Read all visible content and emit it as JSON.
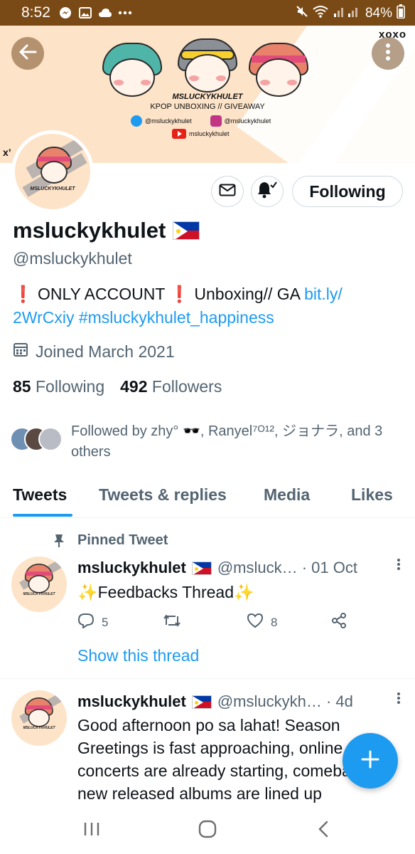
{
  "status_bar": {
    "time": "8:52",
    "icons": [
      "messenger-icon",
      "gallery-icon",
      "cloud-icon",
      "more-dots-icon"
    ],
    "battery": "84%"
  },
  "banner": {
    "brand": "MSLUCKYKHULET",
    "tagline": "KPOP UNBOXING // GIVEAWAY",
    "twitter": "@msluckykhulet",
    "instagram": "@msluckykhulet",
    "youtube": "msluckykhulet",
    "xoxo": "xoxo",
    "xo_left": "x’"
  },
  "avatar_label": "MSLUCKYKHULET",
  "profile": {
    "display_name": "msluckykhulet",
    "handle": "@msluckykhulet",
    "bio_excl_1": "❗",
    "bio_part_1": " ONLY ACCOUNT ",
    "bio_excl_2": "❗",
    "bio_part_2": " Unboxing// GA ",
    "bio_link": "bit.ly/",
    "bio_link_2": "2WrCxiy",
    "bio_hashtag": " #msluckykhulet_happiness",
    "joined": "Joined March 2021",
    "following_count": "85",
    "following_label": "Following",
    "followers_count": "492",
    "followers_label": "Followers",
    "followed_by": "Followed by zhy° 🕶️, Ranyel⁷ᴼ¹², ジョナラ, and 3 others"
  },
  "follow_button": "Following",
  "tabs": [
    "Tweets",
    "Tweets & replies",
    "Media",
    "Likes"
  ],
  "tweets": [
    {
      "pinned_label": "Pinned Tweet",
      "name": "msluckykhulet",
      "meta": "@msluck… · 01 Oct",
      "body": "✨Feedbacks Thread✨",
      "replies": "5",
      "retweets": "",
      "likes": "8",
      "show_thread": "Show this thread"
    },
    {
      "name": "msluckykhulet",
      "meta": "@msluckykh… · 4d",
      "body": "Good afternoon po sa lahat! Season Greetings is fast approaching, online concerts are already starting, comebacks or new released albums are lined up"
    }
  ],
  "colors": {
    "accent": "#1d9bf0",
    "status_bar": "#7a4a16",
    "banner_bg": "#fde3c8",
    "text_secondary": "#536471"
  }
}
